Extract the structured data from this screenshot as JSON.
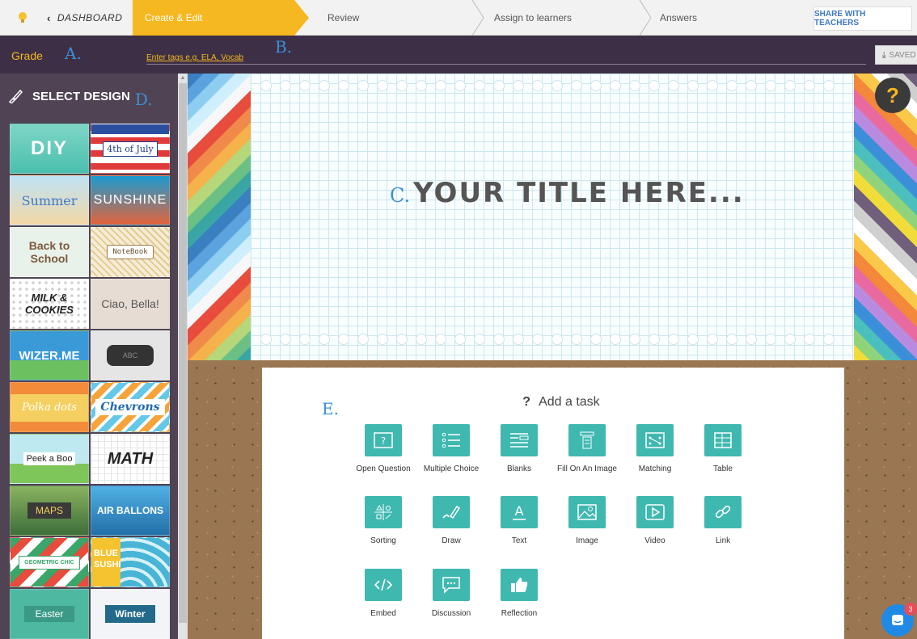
{
  "nav": {
    "dashboard_label": "DASHBOARD",
    "steps": [
      {
        "label": "Create & Edit"
      },
      {
        "label": "Review"
      },
      {
        "label": "Assign to learners"
      },
      {
        "label": "Answers"
      }
    ],
    "share_label": "SHARE WITH TEACHERS"
  },
  "tagbar": {
    "grade_label": "Grade",
    "tags_placeholder": "Enter tags e.g. ELA, Vocab",
    "saved_label": "SAVED"
  },
  "annotations": {
    "a": "A.",
    "b": "B.",
    "c": "C.",
    "d": "D.",
    "e": "E."
  },
  "sidebar": {
    "title": "SELECT DESIGN",
    "designs": [
      {
        "label": "DIY"
      },
      {
        "label": "4th of July"
      },
      {
        "label": "Summer"
      },
      {
        "label": "SUNSHINE"
      },
      {
        "label": "Back to School"
      },
      {
        "label": "NoteBook"
      },
      {
        "label": "MILK & COOKIES"
      },
      {
        "label": "Ciao, Bella!"
      },
      {
        "label": "WIZER.ME"
      },
      {
        "label": "ABC"
      },
      {
        "label": "Polka dots"
      },
      {
        "label": "Chevrons"
      },
      {
        "label": "Peek a Boo"
      },
      {
        "label": "MATH"
      },
      {
        "label": "MAPS"
      },
      {
        "label": "AIR BALLONS"
      },
      {
        "label": "GEOMETRIC CHIC"
      },
      {
        "label": "BLUE SUSHI"
      },
      {
        "label": "Easter"
      },
      {
        "label": "Winter"
      }
    ]
  },
  "canvas": {
    "title": "YOUR TITLE HERE...",
    "help_glyph": "?"
  },
  "tasks": {
    "heading": "Add a task",
    "heading_glyph": "?",
    "items": [
      {
        "label": "Open Question",
        "icon": "open-question-icon"
      },
      {
        "label": "Multiple Choice",
        "icon": "multiple-choice-icon"
      },
      {
        "label": "Blanks",
        "icon": "blanks-icon"
      },
      {
        "label": "Fill On An Image",
        "icon": "fill-on-image-icon"
      },
      {
        "label": "Matching",
        "icon": "matching-icon"
      },
      {
        "label": "Table",
        "icon": "table-icon"
      },
      {
        "label": "Sorting",
        "icon": "sorting-icon"
      },
      {
        "label": "Draw",
        "icon": "draw-icon"
      },
      {
        "label": "Text",
        "icon": "text-icon"
      },
      {
        "label": "Image",
        "icon": "image-icon"
      },
      {
        "label": "Video",
        "icon": "video-icon"
      },
      {
        "label": "Link",
        "icon": "link-icon"
      },
      {
        "label": "Embed",
        "icon": "embed-icon"
      },
      {
        "label": "Discussion",
        "icon": "discussion-icon"
      },
      {
        "label": "Reflection",
        "icon": "reflection-icon"
      }
    ]
  },
  "chat": {
    "badge_count": "3"
  },
  "colors": {
    "accent": "#f5b820",
    "task_teal": "#3fb8b0",
    "header_dark": "#3d2f45",
    "annotation_blue": "#3b8fd8"
  }
}
